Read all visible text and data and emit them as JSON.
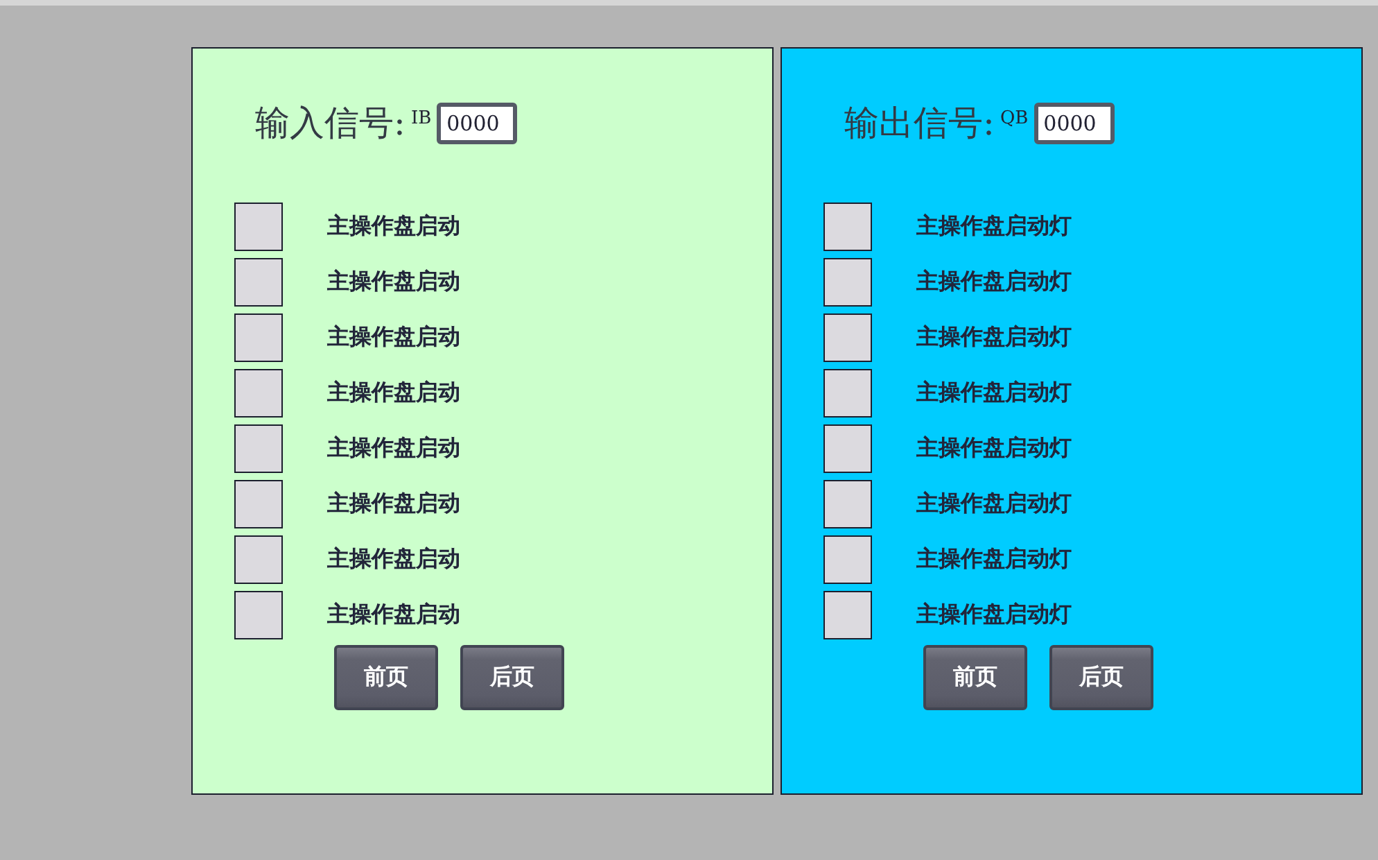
{
  "panels": [
    {
      "title": "输入信号:",
      "prefix": "IB",
      "value": "0000",
      "color": "#ccffcc",
      "signals": [
        {
          "label": "主操作盘启动",
          "on": false
        },
        {
          "label": "主操作盘启动",
          "on": false
        },
        {
          "label": "主操作盘启动",
          "on": false
        },
        {
          "label": "主操作盘启动",
          "on": false
        },
        {
          "label": "主操作盘启动",
          "on": false
        },
        {
          "label": "主操作盘启动",
          "on": false
        },
        {
          "label": "主操作盘启动",
          "on": false
        },
        {
          "label": "主操作盘启动",
          "on": false
        }
      ],
      "buttons": [
        "前页",
        "后页"
      ]
    },
    {
      "title": "输出信号:",
      "prefix": "QB",
      "value": "0000",
      "color": "#00ccff",
      "signals": [
        {
          "label": "主操作盘启动灯",
          "on": false
        },
        {
          "label": "主操作盘启动灯",
          "on": false
        },
        {
          "label": "主操作盘启动灯",
          "on": false
        },
        {
          "label": "主操作盘启动灯",
          "on": false
        },
        {
          "label": "主操作盘启动灯",
          "on": false
        },
        {
          "label": "主操作盘启动灯",
          "on": false
        },
        {
          "label": "主操作盘启动灯",
          "on": false
        },
        {
          "label": "主操作盘启动灯",
          "on": false
        }
      ],
      "buttons": [
        "前页",
        "后页"
      ]
    }
  ]
}
